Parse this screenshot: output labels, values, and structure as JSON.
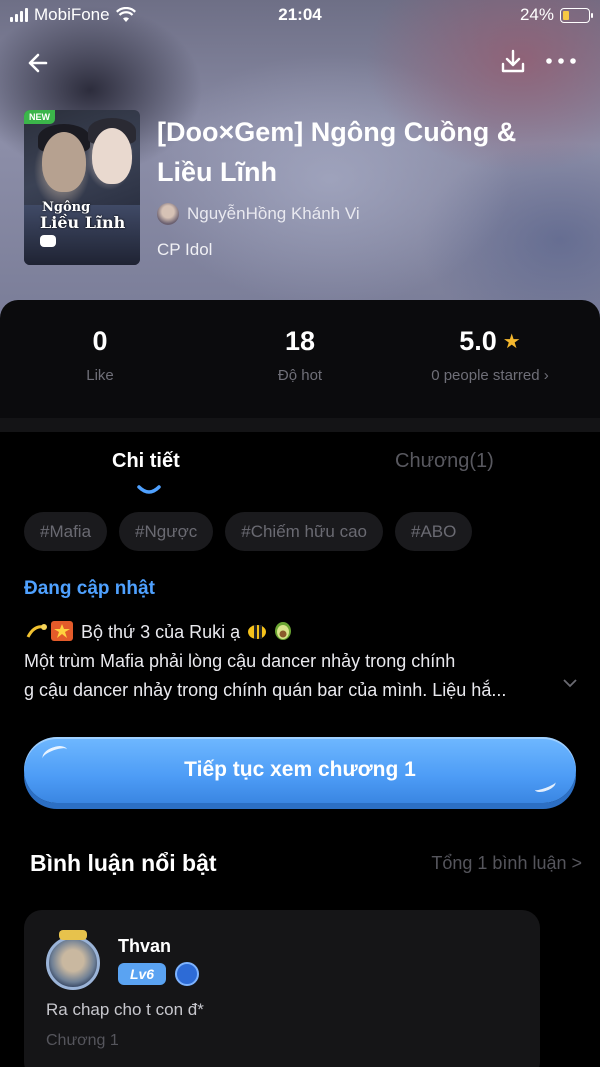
{
  "status_bar": {
    "carrier": "MobiFone",
    "time": "21:04",
    "battery_percent": "24%",
    "battery_level": 0.24
  },
  "nav": {
    "back_icon": "arrow-left-icon",
    "download_icon": "download-icon",
    "more_icon": "more-dots-icon"
  },
  "story": {
    "badge": "NEW",
    "cover_text_1": "Ngông",
    "cover_text_2": "Liều Lĩnh",
    "title": "[Doo×Gem] Ngông Cuồng & Liều Lĩnh",
    "author": "NguyễnHồng Khánh Vi",
    "genre": "CP Idol"
  },
  "stats": {
    "like_value": "0",
    "like_label": "Like",
    "hot_value": "18",
    "hot_label": "Độ hot",
    "rating_value": "5.0",
    "rating_label": "0 people starred",
    "rating_chevron": "›"
  },
  "tabs": {
    "details": "Chi tiết",
    "chapters": "Chương(1)"
  },
  "tags": [
    "#Mafia",
    "#Ngược",
    "#Chiếm hữu cao",
    "#ABO"
  ],
  "status_text": "Đang cập nhật",
  "description": {
    "line1": "Bộ thứ 3 của Ruki ạ",
    "line2": "Một trùm Mafia phải lòng cậu dancer nhảy trong chính",
    "line3": "g cậu dancer nhảy trong chính quán bar của mình. Liệu hắ..."
  },
  "cta_label": "Tiếp tục xem chương 1",
  "comments": {
    "heading": "Bình luận nổi bật",
    "total": "Tổng 1 bình luận >",
    "items": [
      {
        "user": "Thvan",
        "level": "Lv6",
        "text": "Ra chap cho t con đ*",
        "chapter": "Chương 1"
      }
    ]
  },
  "colors": {
    "accent": "#4fa1ff",
    "cta": "#4d9cf6",
    "star": "#f5b82e",
    "new_badge": "#3bb54a",
    "battery": "#f7c843"
  }
}
